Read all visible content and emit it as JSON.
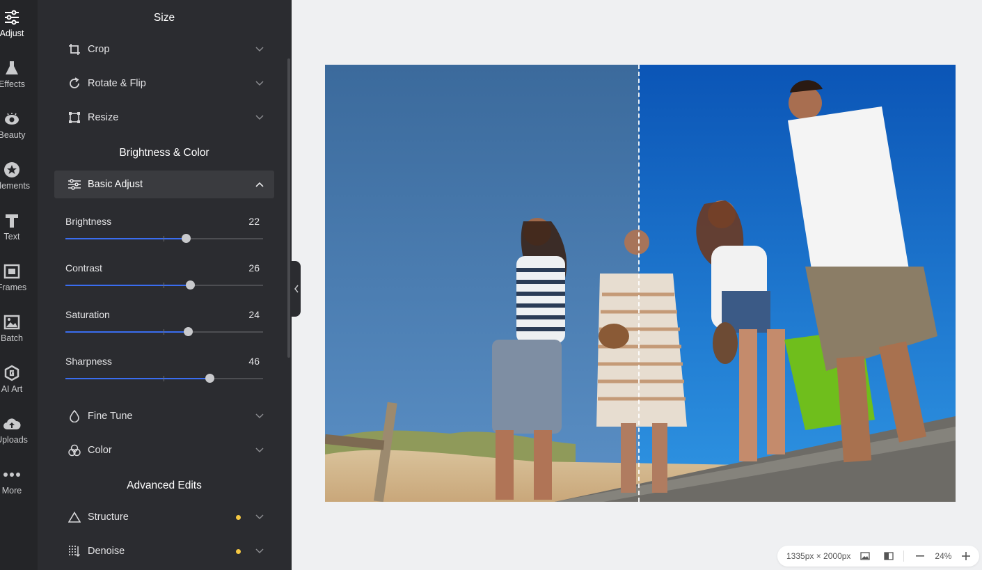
{
  "rail": {
    "items": [
      {
        "label": "Adjust",
        "icon": "sliders-icon"
      },
      {
        "label": "Effects",
        "icon": "flask-icon"
      },
      {
        "label": "Beauty",
        "icon": "eye-icon"
      },
      {
        "label": "Elements",
        "icon": "star-icon"
      },
      {
        "label": "Text",
        "icon": "text-icon"
      },
      {
        "label": "Frames",
        "icon": "frame-icon"
      },
      {
        "label": "Batch",
        "icon": "images-icon"
      },
      {
        "label": "AI Art",
        "icon": "ai-art-icon"
      },
      {
        "label": "Uploads",
        "icon": "cloud-upload-icon"
      },
      {
        "label": "More",
        "icon": "more-icon"
      }
    ]
  },
  "panel": {
    "size_title": "Size",
    "size_items": [
      {
        "label": "Crop",
        "icon": "crop-icon"
      },
      {
        "label": "Rotate & Flip",
        "icon": "rotate-icon"
      },
      {
        "label": "Resize",
        "icon": "resize-icon"
      }
    ],
    "brightness_title": "Brightness & Color",
    "basic_adjust_label": "Basic Adjust",
    "sliders": [
      {
        "label": "Brightness",
        "value": 22
      },
      {
        "label": "Contrast",
        "value": 26
      },
      {
        "label": "Saturation",
        "value": 24
      },
      {
        "label": "Sharpness",
        "value": 46
      }
    ],
    "color_items": [
      {
        "label": "Fine Tune",
        "icon": "droplet-icon"
      },
      {
        "label": "Color",
        "icon": "color-circles-icon"
      }
    ],
    "advanced_title": "Advanced Edits",
    "advanced_items": [
      {
        "label": "Structure",
        "icon": "triangle-icon"
      },
      {
        "label": "Denoise",
        "icon": "denoise-icon"
      }
    ]
  },
  "status": {
    "dimensions": "1335px × 2000px",
    "zoom": "24%"
  },
  "colors": {
    "accent": "#3a6df0",
    "dot": "#f5c842"
  }
}
